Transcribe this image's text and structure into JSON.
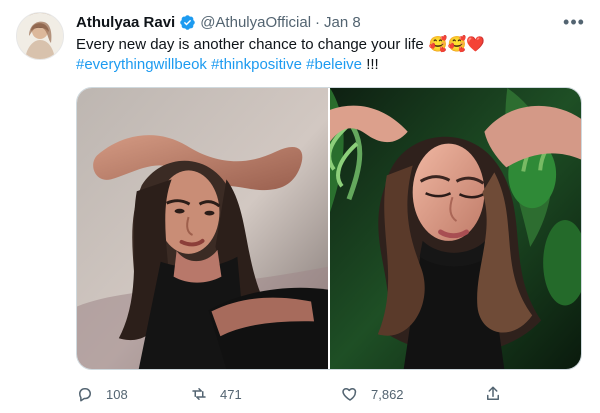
{
  "author": {
    "name": "Athulyaa Ravi",
    "handle": "@AthulyaOfficial",
    "separator": "·",
    "date": "Jan 8",
    "verified": true
  },
  "tweet": {
    "line1": "Every new day is another chance to change your life",
    "emojis": "🥰🥰❤️",
    "hashtags": [
      "#everythingwillbeok",
      "#thinkpositive",
      "#beleive"
    ],
    "ending": "!!!"
  },
  "actions": {
    "reply_count": "108",
    "retweet_count": "471",
    "like_count": "7,862"
  },
  "icons": {
    "more": "more-options-icon",
    "reply": "reply-icon",
    "retweet": "retweet-icon",
    "like": "heart-icon",
    "share": "share-icon"
  },
  "colors": {
    "text": "#0f1419",
    "muted": "#536471",
    "link": "#1d9bf0",
    "border": "#cfd9de"
  }
}
